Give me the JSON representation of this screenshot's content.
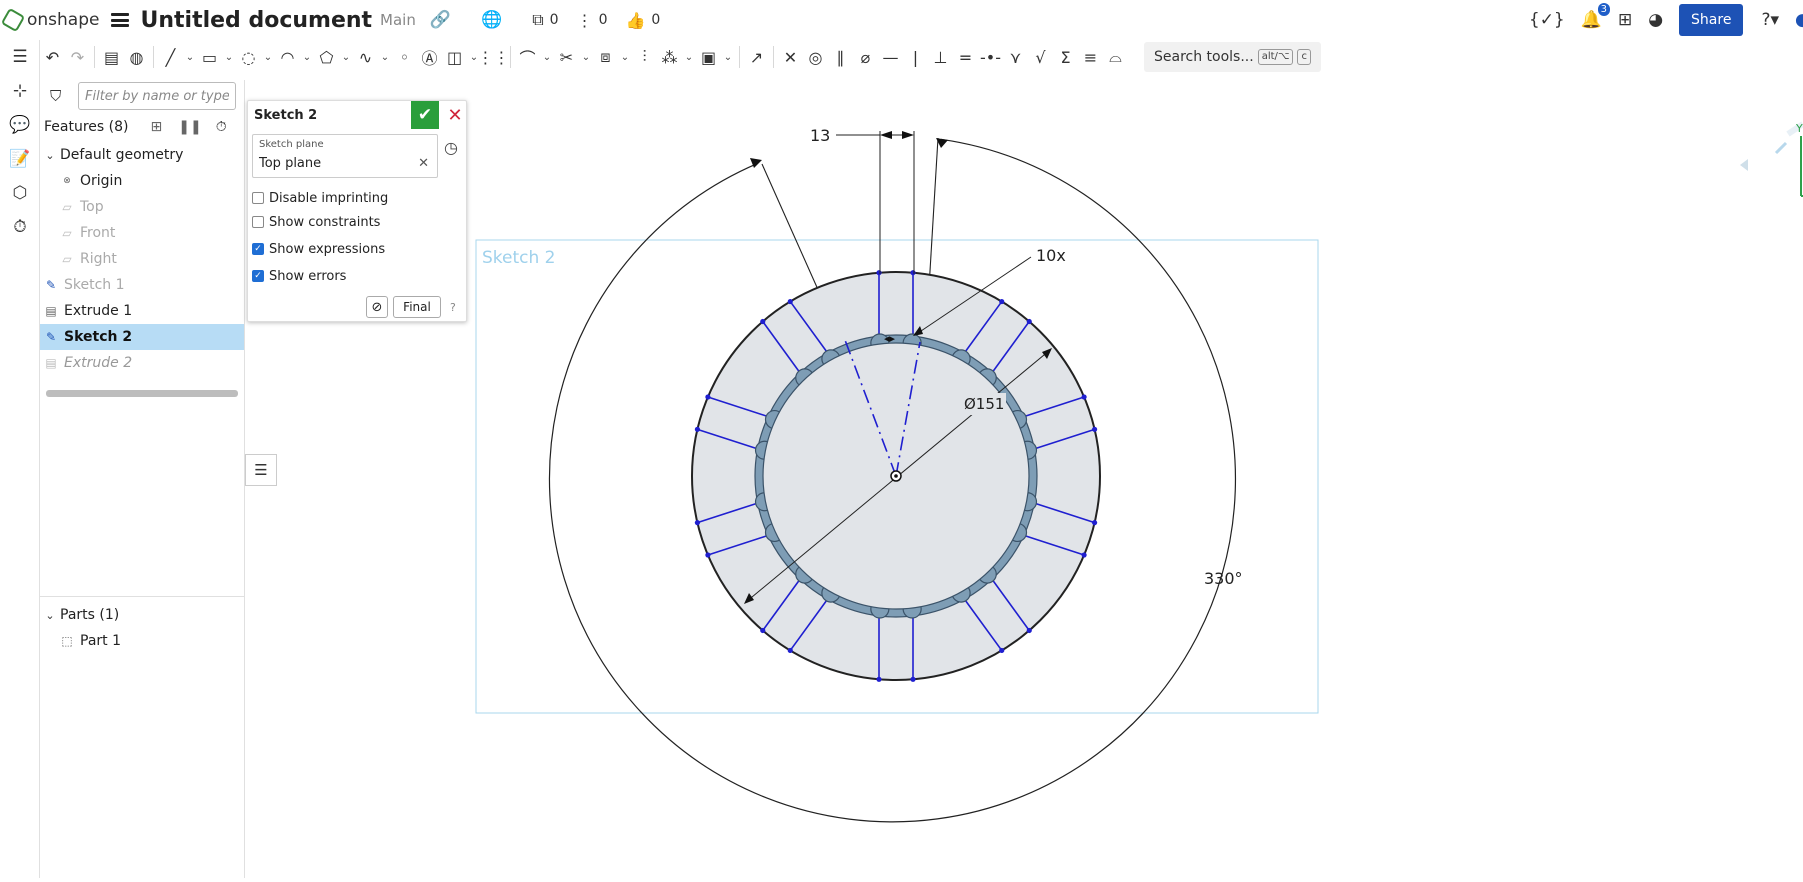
{
  "app": {
    "logo_text": "onshape"
  },
  "document": {
    "title": "Untitled document",
    "branch": "Main"
  },
  "counters": {
    "versions": "0",
    "branches": "0",
    "likes": "0"
  },
  "notifications": {
    "count": "3"
  },
  "header": {
    "share_label": "Share"
  },
  "search_tools": {
    "label": "Search tools...",
    "key1": "alt/⌥",
    "key2": "c"
  },
  "filter": {
    "placeholder": "Filter by name or type"
  },
  "features": {
    "header": "Features (8)",
    "default_geometry": "Default geometry",
    "items": [
      "Origin",
      "Top",
      "Front",
      "Right",
      "Sketch 1",
      "Extrude 1",
      "Sketch 2",
      "Extrude 2"
    ]
  },
  "parts": {
    "header": "Parts (1)",
    "items": [
      "Part 1"
    ]
  },
  "sketch_dialog": {
    "title": "Sketch 2",
    "plane_label": "Sketch plane",
    "plane_value": "Top plane",
    "options": [
      {
        "label": "Disable imprinting",
        "checked": false
      },
      {
        "label": "Show constraints",
        "checked": false
      },
      {
        "label": "Show expressions",
        "checked": true
      },
      {
        "label": "Show errors",
        "checked": true
      }
    ],
    "final_label": "Final"
  },
  "canvas": {
    "sketch_label": "Sketch 2",
    "dim_width": "13",
    "dim_pattern": "10x",
    "dim_diameter": "Ø151",
    "dim_angle": "330°",
    "axis_label": "Y"
  },
  "colors": {
    "accent": "#1d52b5",
    "sketch_blue": "#1f1fd0",
    "selection": "#b7dcf5",
    "ring_fill": "#7e9db5",
    "confirm": "#2a9e3b"
  }
}
